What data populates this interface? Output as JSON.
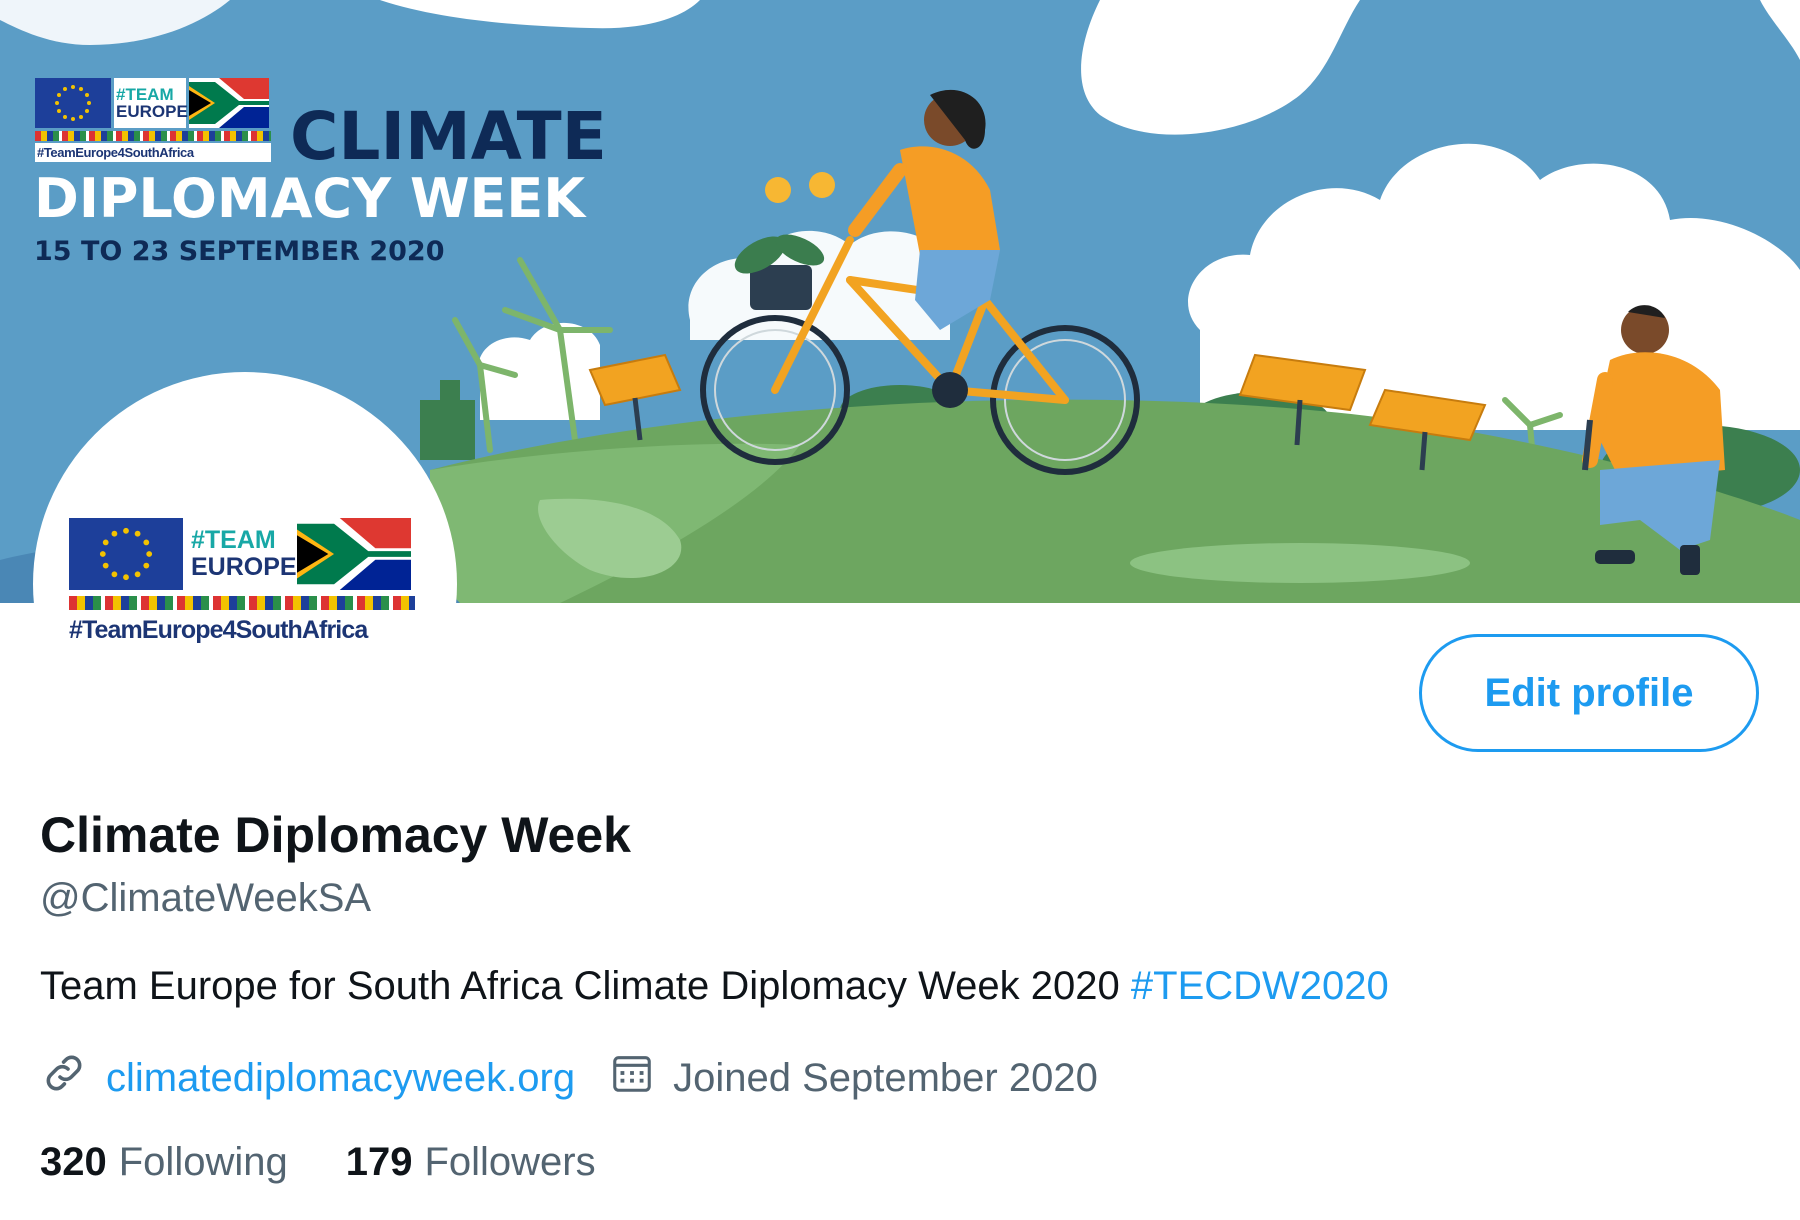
{
  "banner": {
    "logo_team_line1": "#TEAM",
    "logo_team_line2": "EUROPE",
    "logo_hashtag": "#TeamEurope4SouthAfrica",
    "title_line1": "CLIMATE",
    "title_line2": "DIPLOMACY WEEK",
    "dates": "15 TO 23 SEPTEMBER 2020"
  },
  "avatar": {
    "team_line1": "#TEAM",
    "team_line2": "EUROPE",
    "hashtag": "#TeamEurope4SouthAfrica"
  },
  "profile": {
    "edit_label": "Edit profile",
    "display_name": "Climate Diplomacy Week",
    "handle": "@ClimateWeekSA",
    "bio_text": "Team Europe for South Africa Climate Diplomacy Week 2020 ",
    "bio_hashtag": "#TECDW2020",
    "website": "climatediplomacyweek.org",
    "joined": "Joined September 2020",
    "website_icon": "link-icon",
    "joined_icon": "calendar-icon"
  },
  "stats": {
    "following_count": "320",
    "following_label": "Following",
    "followers_count": "179",
    "followers_label": "Followers"
  },
  "colors": {
    "accent": "#1d9bf0",
    "secondary_text": "#536471",
    "sky": "#5b9dc6",
    "grass": "#6da660",
    "navy": "#0e2a56"
  }
}
